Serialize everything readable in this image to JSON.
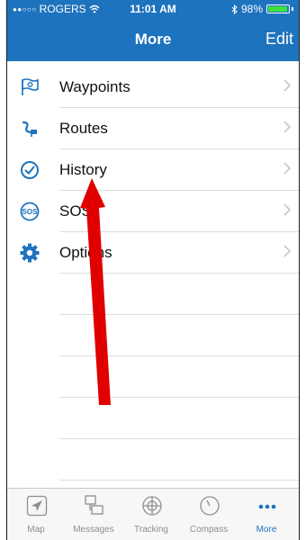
{
  "status_bar": {
    "carrier": "ROGERS",
    "time": "11:01 AM",
    "battery": "98%"
  },
  "nav": {
    "title": "More",
    "edit_label": "Edit"
  },
  "menu": {
    "items": [
      {
        "label": "Waypoints",
        "icon": "waypoint-flag-icon"
      },
      {
        "label": "Routes",
        "icon": "route-icon"
      },
      {
        "label": "History",
        "icon": "history-clock-icon"
      },
      {
        "label": "SOS",
        "icon": "sos-icon"
      },
      {
        "label": "Options",
        "icon": "gear-icon"
      }
    ]
  },
  "tabs": [
    {
      "label": "Map",
      "icon": "map-arrow-icon",
      "active": false
    },
    {
      "label": "Messages",
      "icon": "messages-icon",
      "active": false
    },
    {
      "label": "Tracking",
      "icon": "tracking-icon",
      "active": false
    },
    {
      "label": "Compass",
      "icon": "compass-icon",
      "active": false
    },
    {
      "label": "More",
      "icon": "more-dots-icon",
      "active": true
    }
  ],
  "colors": {
    "header": "#1e73be",
    "accent": "#1e73be",
    "annotation_arrow": "#e00000",
    "battery": "#3ce33c"
  }
}
